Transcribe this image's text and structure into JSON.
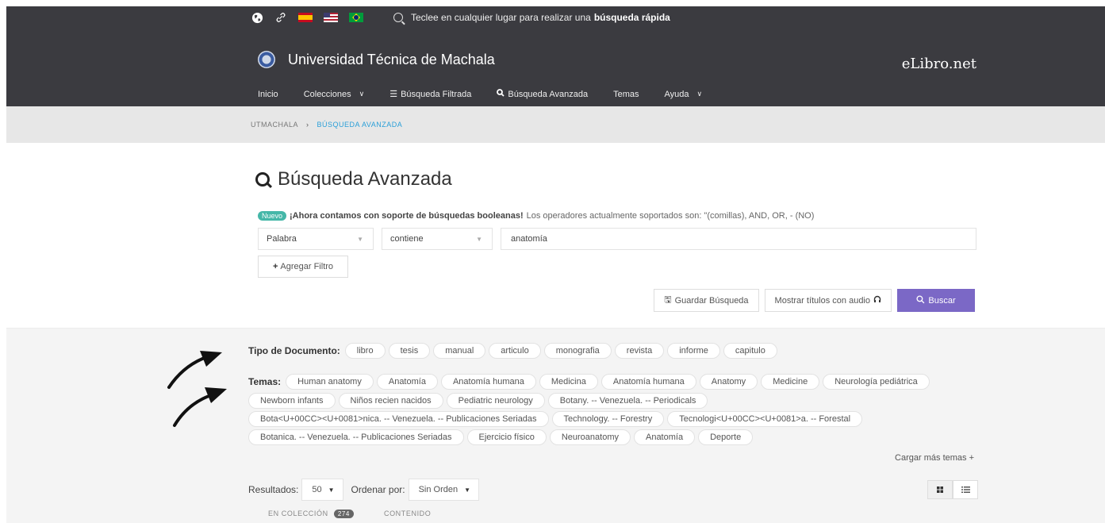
{
  "topbar": {
    "icons": [
      "globe-icon",
      "link-icon"
    ],
    "quick_search_prefix": "Teclee en cualquier lugar para realizar una",
    "quick_search_bold": "búsqueda rápida"
  },
  "brand": {
    "university": "Universidad Técnica de Machala",
    "site": "eLibro.net"
  },
  "nav": {
    "items": [
      "Inicio",
      "Colecciones",
      "Búsqueda Filtrada",
      "Búsqueda Avanzada",
      "Temas",
      "Ayuda"
    ]
  },
  "breadcrumb": {
    "root": "UTMACHALA",
    "separator": "›",
    "current": "BÚSQUEDA AVANZADA"
  },
  "page": {
    "title": "Búsqueda Avanzada",
    "badge": "Nuevo",
    "notice_bold": "¡Ahora contamos con soporte de búsquedas booleanas!",
    "notice_rest": "Los operadores actualmente soportados son: \"(comillas), AND, OR, - (NO)"
  },
  "filter": {
    "field": "Palabra",
    "operator": "contiene",
    "query": "anatomía",
    "add_label": "Agregar Filtro"
  },
  "actions": {
    "save": "Guardar Búsqueda",
    "audio": "Mostrar títulos con audio",
    "search": "Buscar"
  },
  "facets": {
    "doc_type_label": "Tipo de Documento:",
    "doc_types": [
      "libro",
      "tesis",
      "manual",
      "articulo",
      "monografia",
      "revista",
      "informe",
      "capitulo"
    ],
    "temas_label": "Temas:",
    "temas_row1": [
      "Human anatomy",
      "Anatomía",
      "Anatomía humana",
      "Medicina",
      "Anatomía humana",
      "Anatomy",
      "Medicine",
      "Neurología pediátrica"
    ],
    "temas_row2": [
      "Newborn infants",
      "Niños recien nacidos",
      "Pediatric neurology",
      "Botany. -- Venezuela. -- Periodicals"
    ],
    "temas_row3": [
      "Bota<U+00CC><U+0081>nica. -- Venezuela. -- Publicaciones Seriadas",
      "Technology. -- Forestry",
      "Tecnologi<U+00CC><U+0081>a. -- Forestal"
    ],
    "temas_row4": [
      "Botanica. -- Venezuela. -- Publicaciones Seriadas",
      "Ejercicio físico",
      "Neuroanatomy",
      "Anatomía",
      "Deporte"
    ],
    "more": "Cargar más temas +"
  },
  "results": {
    "label": "Resultados:",
    "per_page": "50",
    "sort_label": "Ordenar por:",
    "sort_value": "Sin Orden"
  },
  "tabs": {
    "collection": "EN COLECCIÓN",
    "collection_count": "274",
    "content": "CONTENIDO"
  }
}
